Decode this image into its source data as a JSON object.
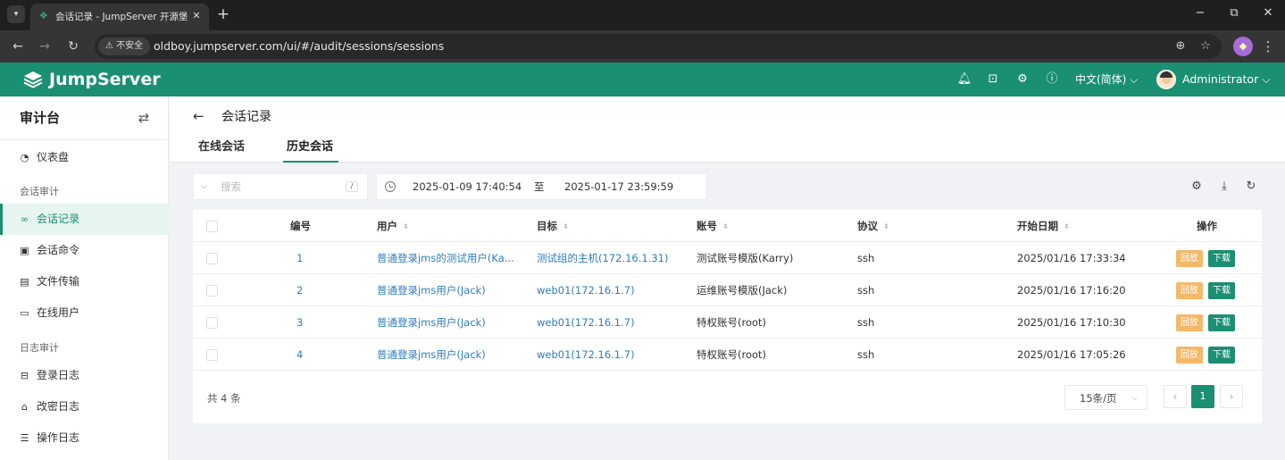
{
  "browser": {
    "tab_title": "会话记录 - JumpServer 开源堡垒机",
    "insecure_label": "不安全",
    "url": "oldboy.jumpserver.com/ui/#/audit/sessions/sessions"
  },
  "header": {
    "brand": "JumpServer",
    "language": "中文(简体)",
    "user": "Administrator",
    "icons": [
      "bell-icon",
      "terminal-icon",
      "settings-icon",
      "help-icon"
    ]
  },
  "sidebar": {
    "title": "审计台",
    "items": [
      {
        "label": "仪表盘",
        "icon": "dashboard-icon"
      },
      {
        "label": "会话记录",
        "icon": "link-icon",
        "active": true
      },
      {
        "label": "会话命令",
        "icon": "terminal-icon"
      },
      {
        "label": "文件传输",
        "icon": "folder-icon"
      },
      {
        "label": "在线用户",
        "icon": "monitor-icon"
      },
      {
        "label": "登录日志",
        "icon": "login-icon"
      },
      {
        "label": "改密日志",
        "icon": "lock-icon"
      },
      {
        "label": "操作日志",
        "icon": "list-icon"
      }
    ],
    "groups": [
      "会话审计",
      "日志审计"
    ]
  },
  "page": {
    "title": "会话记录",
    "tabs": [
      "在线会话",
      "历史会话"
    ],
    "active_tab": "历史会话"
  },
  "filters": {
    "search_placeholder": "搜索",
    "shortcut": "/",
    "date_from": "2025-01-09 17:40:54",
    "date_sep": "至",
    "date_to": "2025-01-17 23:59:59"
  },
  "table": {
    "columns": [
      "编号",
      "用户",
      "目标",
      "账号",
      "协议",
      "开始日期",
      "操作"
    ],
    "rows": [
      {
        "id": "1",
        "user": "普通登录jms的测试用户(Ka...",
        "target": "测试组的主机(172.16.1.31)",
        "account": "测试账号模版(Karry)",
        "protocol": "ssh",
        "start": "2025/01/16 17:33:34"
      },
      {
        "id": "2",
        "user": "普通登录jms用户(Jack)",
        "target": "web01(172.16.1.7)",
        "account": "运维账号模版(Jack)",
        "protocol": "ssh",
        "start": "2025/01/16 17:16:20"
      },
      {
        "id": "3",
        "user": "普通登录jms用户(Jack)",
        "target": "web01(172.16.1.7)",
        "account": "特权账号(root)",
        "protocol": "ssh",
        "start": "2025/01/16 17:10:30"
      },
      {
        "id": "4",
        "user": "普通登录jms用户(Jack)",
        "target": "web01(172.16.1.7)",
        "account": "特权账号(root)",
        "protocol": "ssh",
        "start": "2025/01/16 17:05:26"
      }
    ],
    "replay_label": "回放",
    "download_label": "下载"
  },
  "pagination": {
    "total": "共 4 条",
    "page_size": "15条/页",
    "current_page": "1"
  },
  "colors": {
    "brand": "#1a8f72",
    "link": "#2d7ec0",
    "replay": "#f5b86a"
  }
}
